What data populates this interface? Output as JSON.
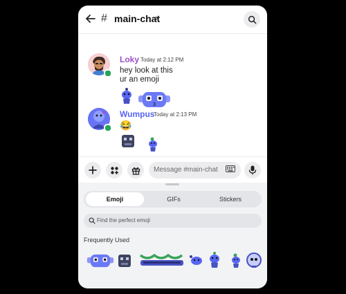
{
  "header": {
    "hash": "#",
    "channel": "main-chat",
    "chevron": "›"
  },
  "messages": [
    {
      "author": "Loky",
      "author_color": "#9b4fc4",
      "time": "Today at 2:12 PM",
      "lines": [
        "hey look at this",
        "ur an emoji"
      ]
    },
    {
      "author": "Wumpus",
      "author_color": "#5865f2",
      "time": "Today at 2:13 PM",
      "emoji": "😂"
    }
  ],
  "composer": {
    "placeholder": "Message #main-chat"
  },
  "emoji_panel": {
    "tabs": [
      {
        "label": "Emoji",
        "active": true
      },
      {
        "label": "GIFs",
        "active": false
      },
      {
        "label": "Stickers",
        "active": false
      }
    ],
    "search_placeholder": "Find the perfect emoji",
    "section_title": "Frequently Used"
  },
  "colors": {
    "blurple": "#5865f2",
    "online": "#23a55a",
    "green_sticker": "#3aa35a"
  }
}
